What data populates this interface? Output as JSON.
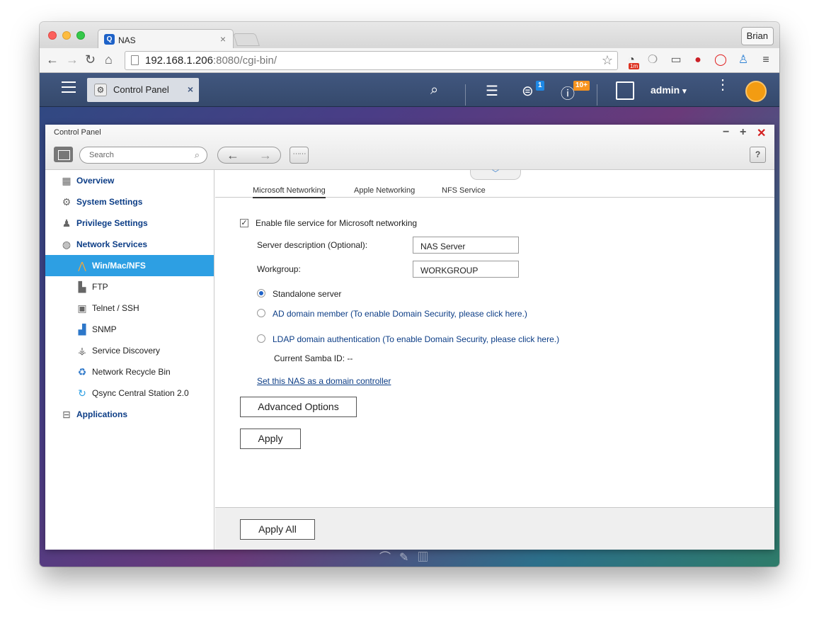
{
  "browser": {
    "tab_title": "NAS",
    "tab_close": "×",
    "profile_name": "Brian",
    "url_host": "192.168.1.206",
    "url_rest": ":8080/cgi-bin/",
    "ext_badge": "1m"
  },
  "qts": {
    "app_tab_label": "Control Panel",
    "app_tab_close": "×",
    "notif_badge_1": "1",
    "notif_badge_2": "10+",
    "user": "admin",
    "user_caret": "▾"
  },
  "window": {
    "title": "Control Panel",
    "search_placeholder": "Search",
    "help": "?"
  },
  "sidebar": {
    "items": [
      {
        "label": "Overview",
        "icon": "grid-icon"
      },
      {
        "label": "System Settings",
        "icon": "gear-icon"
      },
      {
        "label": "Privilege Settings",
        "icon": "user-icon"
      },
      {
        "label": "Network Services",
        "icon": "globe-icon"
      },
      {
        "label": "Win/Mac/NFS",
        "icon": "network-icon"
      },
      {
        "label": "FTP",
        "icon": "folder-icon"
      },
      {
        "label": "Telnet / SSH",
        "icon": "terminal-icon"
      },
      {
        "label": "SNMP",
        "icon": "bar-chart-icon"
      },
      {
        "label": "Service Discovery",
        "icon": "satellite-icon"
      },
      {
        "label": "Network Recycle Bin",
        "icon": "recycle-icon"
      },
      {
        "label": "Qsync Central Station 2.0",
        "icon": "sync-icon"
      },
      {
        "label": "Applications",
        "icon": "inbox-icon"
      }
    ]
  },
  "tabs": [
    "Microsoft Networking",
    "Apple Networking",
    "NFS Service"
  ],
  "form": {
    "enable_label": "Enable file service for Microsoft networking",
    "enable_checked": true,
    "server_desc_label": "Server description (Optional):",
    "server_desc_value": "NAS Server",
    "workgroup_label": "Workgroup:",
    "workgroup_value": "WORKGROUP",
    "radio_standalone": "Standalone server",
    "radio_ad": "AD domain member (To enable Domain Security, please click here.)",
    "radio_ldap": "LDAP domain authentication (To enable Domain Security, please click here.)",
    "samba_id": "Current Samba ID: --",
    "domain_controller_link": "Set this NAS as a domain controller",
    "advanced_button": "Advanced Options",
    "apply_button": "Apply"
  },
  "footer": {
    "apply_all_button": "Apply All"
  },
  "colors": {
    "accent": "#2d9fe3",
    "link": "#0c3d86",
    "badge": "#f7931e"
  }
}
